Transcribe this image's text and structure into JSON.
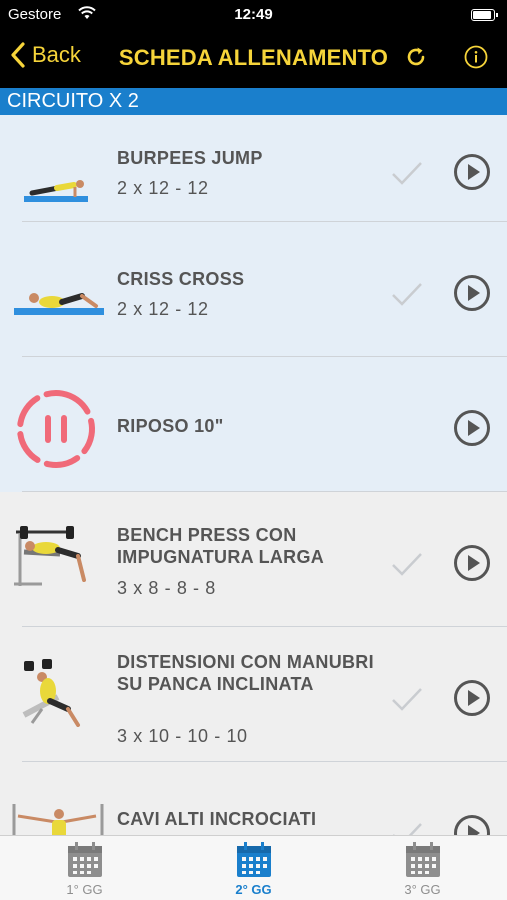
{
  "status_bar": {
    "carrier": "Gestore",
    "time": "12:49"
  },
  "nav": {
    "back_label": "Back",
    "title": "SCHEDA ALLENAMENTO"
  },
  "section": {
    "title": "CIRCUITO X 2"
  },
  "exercises": [
    {
      "name": "BURPEES JUMP",
      "reps": "2 x 12 - 12",
      "highlight": true,
      "done": true
    },
    {
      "name": "CRISS CROSS",
      "reps": "2 x 12 - 12",
      "highlight": true,
      "done": true
    },
    {
      "name": "RIPOSO 10\"",
      "reps": "",
      "highlight": true,
      "done": false
    },
    {
      "name": "BENCH PRESS CON IMPUGNATURA LARGA",
      "reps": "3 x 8 - 8 - 8",
      "highlight": false,
      "done": true
    },
    {
      "name": "DISTENSIONI CON MANUBRI SU PANCA INCLINATA",
      "reps": "3 x 10 - 10 - 10",
      "highlight": false,
      "done": true
    },
    {
      "name": "CAVI ALTI INCROCIATI",
      "reps": "",
      "highlight": false,
      "done": true
    }
  ],
  "tabs": [
    {
      "label": "1° GG",
      "active": false
    },
    {
      "label": "2° GG",
      "active": true
    },
    {
      "label": "3° GG",
      "active": false
    }
  ],
  "colors": {
    "accent_yellow": "#f6d43a",
    "section_blue": "#1a7fcc",
    "rest_red": "#f06a79",
    "row_highlight": "#e5eef7"
  },
  "icons": [
    "back-chevron-icon",
    "refresh-icon",
    "info-icon",
    "check-icon",
    "play-icon",
    "pause-timer-icon",
    "calendar-icon"
  ]
}
